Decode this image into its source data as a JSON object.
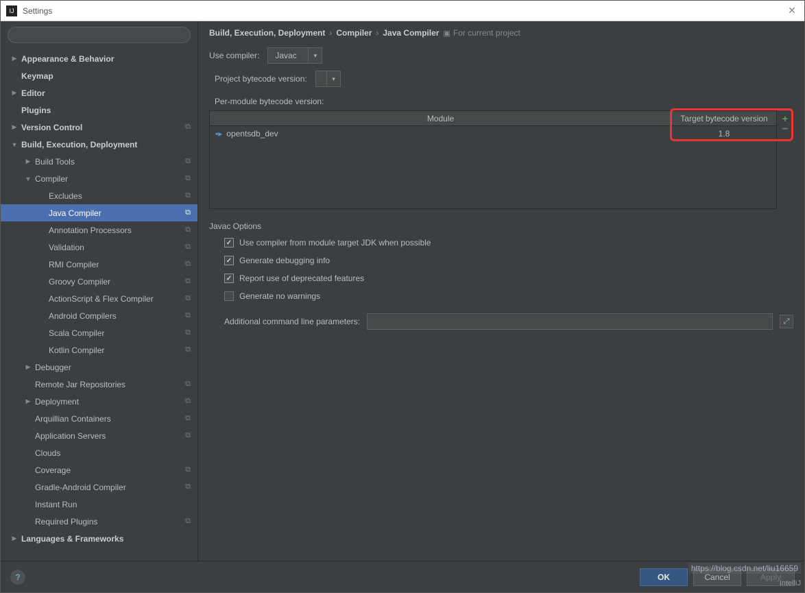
{
  "window": {
    "title": "Settings"
  },
  "search": {
    "placeholder": ""
  },
  "tree": [
    {
      "label": "Appearance & Behavior",
      "level": 0,
      "arrow": "▶",
      "bold": true
    },
    {
      "label": "Keymap",
      "level": 0,
      "arrow": "",
      "bold": true
    },
    {
      "label": "Editor",
      "level": 0,
      "arrow": "▶",
      "bold": true
    },
    {
      "label": "Plugins",
      "level": 0,
      "arrow": "",
      "bold": true
    },
    {
      "label": "Version Control",
      "level": 0,
      "arrow": "▶",
      "bold": true,
      "icon": true
    },
    {
      "label": "Build, Execution, Deployment",
      "level": 0,
      "arrow": "▼",
      "bold": true
    },
    {
      "label": "Build Tools",
      "level": 1,
      "arrow": "▶",
      "icon": true
    },
    {
      "label": "Compiler",
      "level": 1,
      "arrow": "▼",
      "icon": true
    },
    {
      "label": "Excludes",
      "level": 2,
      "icon": true
    },
    {
      "label": "Java Compiler",
      "level": 2,
      "icon": true,
      "selected": true
    },
    {
      "label": "Annotation Processors",
      "level": 2,
      "icon": true
    },
    {
      "label": "Validation",
      "level": 2,
      "icon": true
    },
    {
      "label": "RMI Compiler",
      "level": 2,
      "icon": true
    },
    {
      "label": "Groovy Compiler",
      "level": 2,
      "icon": true
    },
    {
      "label": "ActionScript & Flex Compiler",
      "level": 2,
      "icon": true
    },
    {
      "label": "Android Compilers",
      "level": 2,
      "icon": true
    },
    {
      "label": "Scala Compiler",
      "level": 2,
      "icon": true
    },
    {
      "label": "Kotlin Compiler",
      "level": 2,
      "icon": true
    },
    {
      "label": "Debugger",
      "level": 1,
      "arrow": "▶"
    },
    {
      "label": "Remote Jar Repositories",
      "level": 1,
      "icon": true
    },
    {
      "label": "Deployment",
      "level": 1,
      "arrow": "▶",
      "icon": true
    },
    {
      "label": "Arquillian Containers",
      "level": 1,
      "icon": true
    },
    {
      "label": "Application Servers",
      "level": 1,
      "icon": true
    },
    {
      "label": "Clouds",
      "level": 1
    },
    {
      "label": "Coverage",
      "level": 1,
      "icon": true
    },
    {
      "label": "Gradle-Android Compiler",
      "level": 1,
      "icon": true
    },
    {
      "label": "Instant Run",
      "level": 1
    },
    {
      "label": "Required Plugins",
      "level": 1,
      "icon": true
    },
    {
      "label": "Languages & Frameworks",
      "level": 0,
      "arrow": "▶",
      "bold": true
    }
  ],
  "breadcrumb": {
    "a": "Build, Execution, Deployment",
    "b": "Compiler",
    "c": "Java Compiler",
    "hint": "For current project"
  },
  "compiler": {
    "use_compiler_label": "Use compiler:",
    "use_compiler_value": "Javac",
    "project_bytecode_label": "Project bytecode version:",
    "per_module_label": "Per-module bytecode version:",
    "table_head_module": "Module",
    "table_head_target": "Target bytecode version",
    "row_module": "opentsdb_dev",
    "row_target": "1.8"
  },
  "javac": {
    "section": "Javac Options",
    "opt1": "Use compiler from module target JDK when possible",
    "opt2": "Generate debugging info",
    "opt3": "Report use of deprecated features",
    "opt4": "Generate no warnings",
    "params_label": "Additional command line parameters:"
  },
  "footer": {
    "ok": "OK",
    "cancel": "Cancel",
    "apply": "Apply"
  },
  "watermark": "https://blog.csdn.net/liu16659",
  "intellij": "IntelliJ"
}
